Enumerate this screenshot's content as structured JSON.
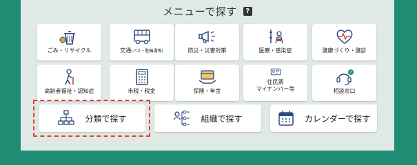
{
  "header": {
    "title": "メニューで探す",
    "help_icon": "help-icon"
  },
  "categories_row1": [
    {
      "label": "ごみ・リサイクル",
      "icon": "recycle-icon"
    },
    {
      "label": "交通",
      "sub": "(バス・駐輪場等)",
      "icon": "bus-icon"
    },
    {
      "label": "防災・災害対策",
      "icon": "megaphone-icon"
    },
    {
      "label": "医療・感染症",
      "icon": "medical-icon"
    },
    {
      "label": "健康づくり・健診",
      "icon": "heart-pulse-icon"
    }
  ],
  "categories_row2": [
    {
      "label": "高齢者福祉・認知症",
      "icon": "elderly-icon"
    },
    {
      "label": "市税・税金",
      "icon": "tax-calculator-icon"
    },
    {
      "label": "保険・年金",
      "icon": "insurance-card-icon"
    },
    {
      "label1": "住民票",
      "label2": "マイナンバー等",
      "icon": "id-card-icon"
    },
    {
      "label": "相談窓口",
      "icon": "headset-icon"
    }
  ],
  "search_modes": [
    {
      "label": "分類で探す",
      "icon": "hierarchy-icon"
    },
    {
      "label": "組織で探す",
      "icon": "organization-icon"
    },
    {
      "label": "カレンダーで探す",
      "icon": "calendar-icon"
    }
  ],
  "colors": {
    "accent": "#1f8d74",
    "panel": "#dfe9e5",
    "icon": "#2c4a7c",
    "highlight_border": "#e53935"
  }
}
